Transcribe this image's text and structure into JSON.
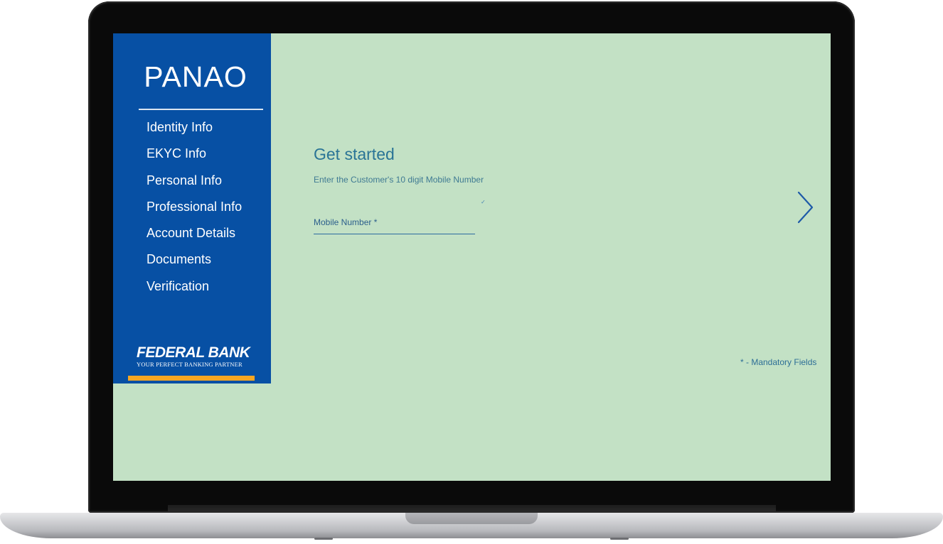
{
  "app": {
    "title": "PANAO"
  },
  "sidebar": {
    "items": [
      {
        "label": "Identity Info"
      },
      {
        "label": "EKYC Info"
      },
      {
        "label": "Personal Info"
      },
      {
        "label": "Professional Info"
      },
      {
        "label": "Account Details"
      },
      {
        "label": "Documents"
      },
      {
        "label": "Verification"
      }
    ],
    "logo": {
      "name": "FEDERAL BANK",
      "tagline": "YOUR PERFECT BANKING PARTNER"
    }
  },
  "main": {
    "heading": "Get started",
    "subtext": "Enter the Customer's 10 digit Mobile Number",
    "mobile_field": {
      "placeholder": "Mobile Number *",
      "value": ""
    },
    "next_icon": "chevron-right-icon",
    "mandatory_note": "* - Mandatory Fields"
  },
  "colors": {
    "sidebar_bg": "#0750a4",
    "content_bg": "#c3e1c5",
    "accent": "#f6a623",
    "heading": "#2a7496"
  }
}
